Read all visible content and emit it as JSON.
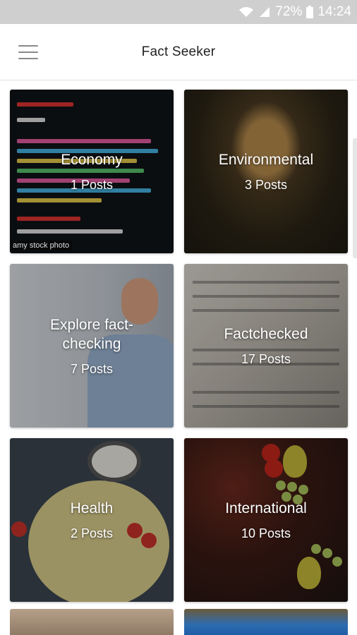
{
  "status_bar": {
    "battery_text": "72%",
    "time": "14:24",
    "icons": [
      "wifi-icon",
      "signal-icon",
      "battery-icon"
    ]
  },
  "app_bar": {
    "title": "Fact Seeker",
    "menu_icon": "hamburger-menu-icon"
  },
  "categories": [
    {
      "title": "Economy",
      "count": "1 Posts",
      "watermark": "amy stock photo"
    },
    {
      "title": "Environmental",
      "count": "3 Posts"
    },
    {
      "title": "Explore fact-checking",
      "count": "7 Posts"
    },
    {
      "title": "Factchecked",
      "count": "17 Posts"
    },
    {
      "title": "Health",
      "count": "2 Posts"
    },
    {
      "title": "International",
      "count": "10 Posts"
    }
  ],
  "colors": {
    "status_bar_bg": "#cfcfcf",
    "app_bar_bg": "#ffffff",
    "card_text": "#ffffff"
  }
}
